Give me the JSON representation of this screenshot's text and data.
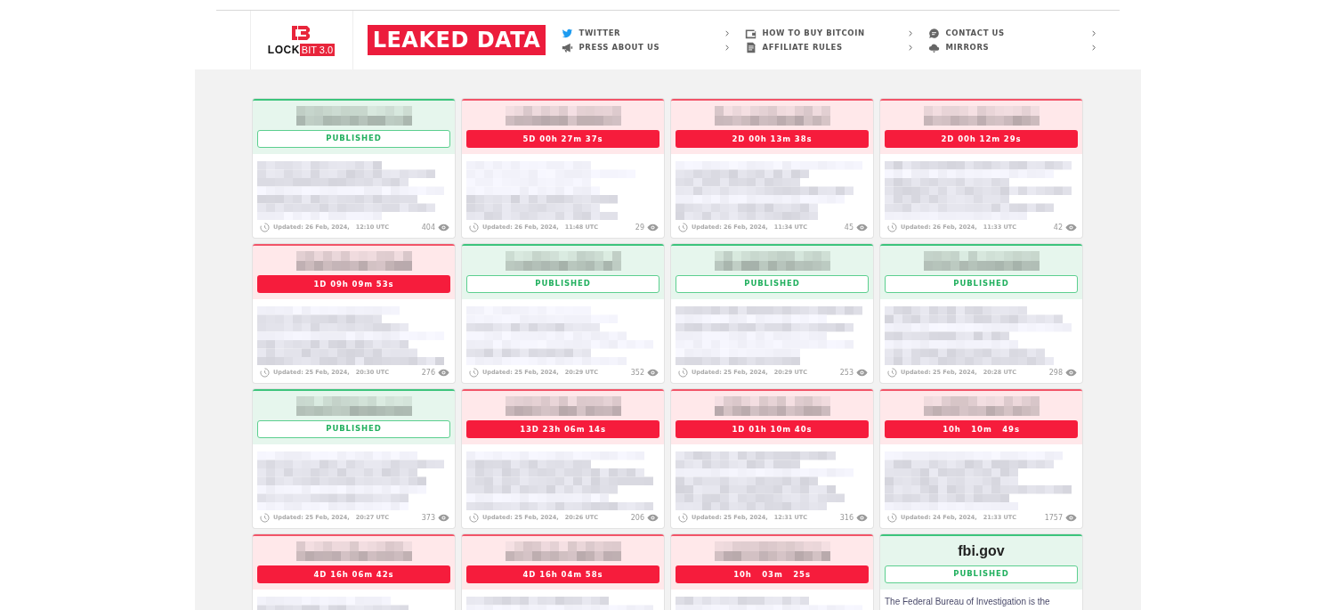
{
  "logo": {
    "word": "LOCK",
    "badge": "BIT 3.0"
  },
  "banner": "LEAKED DATA",
  "nav": [
    {
      "label": "TWITTER",
      "kind": "bird"
    },
    {
      "label": "PRESS ABOUT US",
      "kind": "megaphone"
    },
    {
      "label": "HOW TO BUY BITCOIN",
      "kind": "wallet"
    },
    {
      "label": "AFFILIATE RULES",
      "kind": "document"
    },
    {
      "label": "CONTACT US",
      "kind": "chat"
    },
    {
      "label": "MIRRORS",
      "kind": "cloud"
    }
  ],
  "cards": [
    {
      "kind": "published",
      "badge": "PUBLISHED",
      "updated": "Updated: 26 Feb, 2024,   12:10 UTC",
      "views": "404"
    },
    {
      "kind": "countdown",
      "badge": "5D 00h 27m 37s",
      "updated": "Updated: 26 Feb, 2024,   11:48 UTC",
      "views": "29"
    },
    {
      "kind": "countdown",
      "badge": "2D 00h 13m 38s",
      "updated": "Updated: 26 Feb, 2024,   11:34 UTC",
      "views": "45"
    },
    {
      "kind": "countdown",
      "badge": "2D 00h 12m 29s",
      "updated": "Updated: 26 Feb, 2024,   11:33 UTC",
      "views": "42"
    },
    {
      "kind": "countdown",
      "badge": "1D 09h 09m 53s",
      "updated": "Updated: 25 Feb, 2024,   20:30 UTC",
      "views": "276"
    },
    {
      "kind": "published",
      "badge": "PUBLISHED",
      "updated": "Updated: 25 Feb, 2024,   20:29 UTC",
      "views": "352"
    },
    {
      "kind": "published",
      "badge": "PUBLISHED",
      "updated": "Updated: 25 Feb, 2024,   20:29 UTC",
      "views": "253"
    },
    {
      "kind": "published",
      "badge": "PUBLISHED",
      "updated": "Updated: 25 Feb, 2024,   20:28 UTC",
      "views": "298"
    },
    {
      "kind": "published",
      "badge": "PUBLISHED",
      "updated": "Updated: 25 Feb, 2024,   20:27 UTC",
      "views": "373"
    },
    {
      "kind": "countdown",
      "badge": "13D 23h 06m 14s",
      "updated": "Updated: 25 Feb, 2024,   20:26 UTC",
      "views": "206"
    },
    {
      "kind": "countdown",
      "badge": "1D 01h 10m 40s",
      "updated": "Updated: 25 Feb, 2024,   12:31 UTC",
      "views": "316"
    },
    {
      "kind": "countdown",
      "badge": "10h   10m   49s",
      "updated": "Updated: 24 Feb, 2024,   21:33 UTC",
      "views": "1757"
    },
    {
      "kind": "countdown",
      "badge": "4D 16h 06m 42s"
    },
    {
      "kind": "countdown",
      "badge": "4D 16h 04m 58s"
    },
    {
      "kind": "countdown",
      "badge": "10h   03m   25s"
    },
    {
      "kind": "published",
      "badge": "PUBLISHED",
      "title": "fbi.gov",
      "description": "The Federal Bureau of Investigation is the"
    }
  ]
}
